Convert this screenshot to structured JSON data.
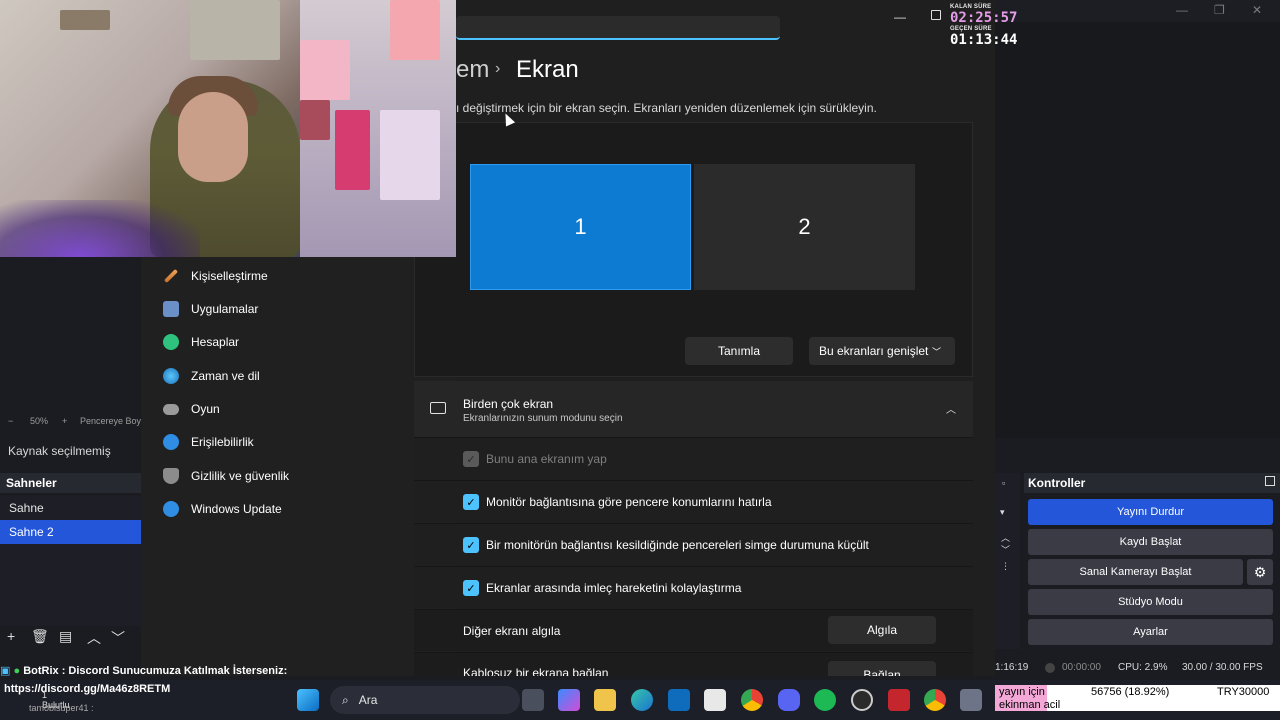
{
  "timer": {
    "remaining_label": "KALAN SÜRE",
    "remaining_value": "02:25:57",
    "elapsed_label": "GEÇEN SÜRE",
    "elapsed_value": "01:13:44"
  },
  "settings": {
    "breadcrumb_prev": "em",
    "breadcrumb_sep": "›",
    "breadcrumb_current": "Ekran",
    "description": "ı değiştirmek için bir ekran seçin. Ekranları yeniden düzenlemek için sürükleyin.",
    "monitors": [
      "1",
      "2"
    ],
    "identify_label": "Tanımla",
    "extend_label": "Bu ekranları genişlet",
    "multi_title": "Birden çok ekran",
    "multi_subtitle": "Ekranlarınızın sunum modunu seçin",
    "options": [
      {
        "label": "Bunu ana ekranım yap",
        "checked": true,
        "disabled": true
      },
      {
        "label": "Monitör bağlantısına göre pencere konumlarını hatırla",
        "checked": true,
        "disabled": false
      },
      {
        "label": "Bir monitörün bağlantısı kesildiğinde pencereleri simge durumuna küçült",
        "checked": true,
        "disabled": false
      },
      {
        "label": "Ekranlar arasında imleç hareketini kolaylaştırma",
        "checked": true,
        "disabled": false
      }
    ],
    "detect_label": "Diğer ekranı algıla",
    "detect_button": "Algıla",
    "wireless_label": "Kablosuz bir ekrana bağlan",
    "wireless_button": "Bağlan",
    "nav": [
      {
        "label": "Kişiselleştirme",
        "icon": "brush-icon"
      },
      {
        "label": "Uygulamalar",
        "icon": "apps-icon"
      },
      {
        "label": "Hesaplar",
        "icon": "person-icon"
      },
      {
        "label": "Zaman ve dil",
        "icon": "globe-icon"
      },
      {
        "label": "Oyun",
        "icon": "gamepad-icon"
      },
      {
        "label": "Erişilebilirlik",
        "icon": "accessibility-icon"
      },
      {
        "label": "Gizlilik ve güvenlik",
        "icon": "shield-icon"
      },
      {
        "label": "Windows Update",
        "icon": "update-icon"
      }
    ]
  },
  "obs": {
    "zoom_minus": "−",
    "zoom_value": "50%",
    "zoom_plus": "+",
    "zoom_fit": "Pencereye Boy",
    "source_none": "Kaynak seçilmemiş",
    "scenes_title": "Sahneler",
    "scenes": [
      "Sahne",
      "Sahne 2"
    ],
    "controls_title": "Kontroller",
    "controls": [
      "Yayını Durdur",
      "Kaydı Başlat",
      "Sanal Kamerayı Başlat",
      "Stüdyo Modu",
      "Ayarlar"
    ],
    "status_time": "1:16:19",
    "status_rec": "00:00:00",
    "status_cpu": "CPU: 2.9%",
    "status_fps": "30.00 / 30.00 FPS"
  },
  "chat": {
    "line": "BotRix : Discord Sunucumuza Katılmak İsterseniz:",
    "link": "https://discord.gg/Ma46z8RETM",
    "user": "tamobisuper41 :",
    "weather_temp": "1",
    "weather_desc": "Bulutlu"
  },
  "taskbar": {
    "search_label": "Ara"
  },
  "ticker": {
    "pink_text": "yayın için",
    "pink_text2": "ekinman acil",
    "value": "56756 (18.92%)",
    "currency": "TRY30000"
  },
  "colors": {
    "accent_blue": "#0d7bd1",
    "obs_active": "#2456d9",
    "check_blue": "#4cc2ff",
    "remaining_pink": "#e59ce8"
  }
}
